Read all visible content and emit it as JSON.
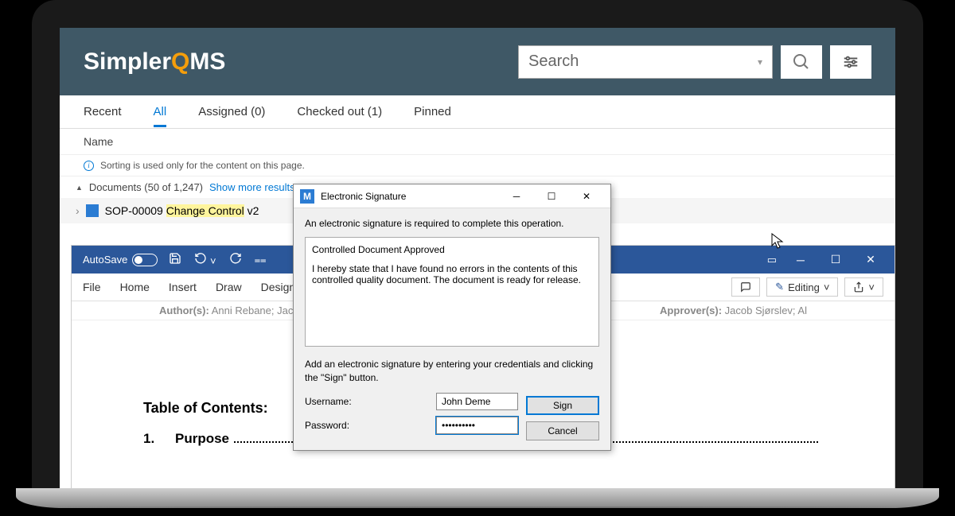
{
  "brand": {
    "prefix": "Simpler",
    "q": "Q",
    "suffix": "MS"
  },
  "search": {
    "placeholder": "Search"
  },
  "tabs": [
    {
      "label": "Recent"
    },
    {
      "label": "All"
    },
    {
      "label": "Assigned (0)"
    },
    {
      "label": "Checked out (1)"
    },
    {
      "label": "Pinned"
    }
  ],
  "column_header": "Name",
  "sort_note": "Sorting is used only for the content on this page.",
  "doc_group": {
    "label": "Documents (50 of 1,247)",
    "more": "Show more results"
  },
  "doc_row": {
    "prefix": "SOP-00009 ",
    "highlight": "Change Control",
    "suffix": " v2"
  },
  "word": {
    "autosave": "AutoSave",
    "ribbon": [
      "File",
      "Home",
      "Insert",
      "Draw",
      "Design"
    ],
    "editing": "Editing",
    "meta_left_label": "Author(s):",
    "meta_left_val": " Anni Rebane; Jacob ",
    "meta_right_label": "Approver(s):",
    "meta_right_val": " Jacob Sjørslev; Al",
    "toc_title": "Table of Contents:",
    "toc_item_num": "1.",
    "toc_item_label": "Purpose"
  },
  "dialog": {
    "title": "Electronic Signature",
    "msg": "An electronic signature is required to complete this operation.",
    "box_line1": "Controlled Document Approved",
    "box_line2": "I hereby state that I have found no errors in the contents of this controlled quality document. The document is ready for release.",
    "instr": "Add an electronic signature by entering your credentials and clicking the \"Sign\" button.",
    "username_label": "Username:",
    "username_value": "John Deme",
    "password_label": "Password:",
    "password_value": "••••••••••",
    "sign": "Sign",
    "cancel": "Cancel"
  }
}
